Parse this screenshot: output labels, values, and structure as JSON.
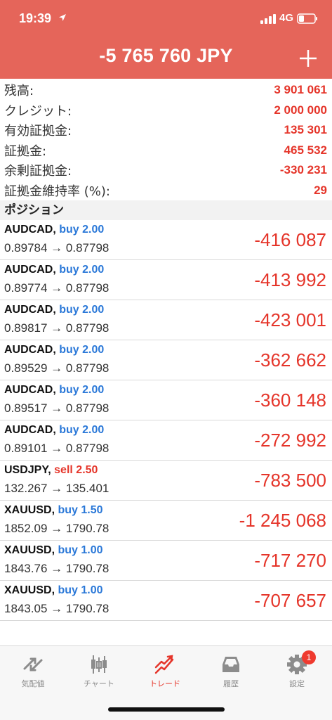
{
  "status": {
    "time": "19:39",
    "network": "4G"
  },
  "header": {
    "balance": "-5 765 760 JPY",
    "add_icon": "plus-icon"
  },
  "summary": [
    {
      "label": "残高:",
      "value": "3 901 061"
    },
    {
      "label": "クレジット:",
      "value": "2 000 000"
    },
    {
      "label": "有効証拠金:",
      "value": "135 301"
    },
    {
      "label": "証拠金:",
      "value": "465 532"
    },
    {
      "label": "余剰証拠金:",
      "value": "-330 231"
    },
    {
      "label": "証拠金維持率 (%):",
      "value": "29"
    }
  ],
  "positions_title": "ポジション",
  "positions": [
    {
      "symbol": "AUDCAD,",
      "side": "buy 2.00",
      "prices": "0.89784 → 0.87798",
      "pl": "-416 087"
    },
    {
      "symbol": "AUDCAD,",
      "side": "buy 2.00",
      "prices": "0.89774 → 0.87798",
      "pl": "-413 992"
    },
    {
      "symbol": "AUDCAD,",
      "side": "buy 2.00",
      "prices": "0.89817 → 0.87798",
      "pl": "-423 001"
    },
    {
      "symbol": "AUDCAD,",
      "side": "buy 2.00",
      "prices": "0.89529 → 0.87798",
      "pl": "-362 662"
    },
    {
      "symbol": "AUDCAD,",
      "side": "buy 2.00",
      "prices": "0.89517 → 0.87798",
      "pl": "-360 148"
    },
    {
      "symbol": "AUDCAD,",
      "side": "buy 2.00",
      "prices": "0.89101 → 0.87798",
      "pl": "-272 992"
    },
    {
      "symbol": "USDJPY,",
      "side": "sell 2.50",
      "prices": "132.267 → 135.401",
      "pl": "-783 500"
    },
    {
      "symbol": "XAUUSD,",
      "side": "buy 1.50",
      "prices": "1852.09 → 1790.78",
      "pl": "-1 245 068"
    },
    {
      "symbol": "XAUUSD,",
      "side": "buy 1.00",
      "prices": "1843.76 → 1790.78",
      "pl": "-717 270"
    },
    {
      "symbol": "XAUUSD,",
      "side": "buy 1.00",
      "prices": "1843.05 → 1790.78",
      "pl": "-707 657"
    }
  ],
  "tabs": [
    {
      "label": "気配値",
      "icon": "quotes-icon"
    },
    {
      "label": "チャート",
      "icon": "chart-icon"
    },
    {
      "label": "トレード",
      "icon": "trade-icon",
      "active": true
    },
    {
      "label": "履歴",
      "icon": "history-icon"
    },
    {
      "label": "設定",
      "icon": "settings-icon",
      "badge": "1"
    }
  ],
  "colors": {
    "header": "#e5655a",
    "negative": "#e5352a",
    "buy": "#2a78d8"
  }
}
